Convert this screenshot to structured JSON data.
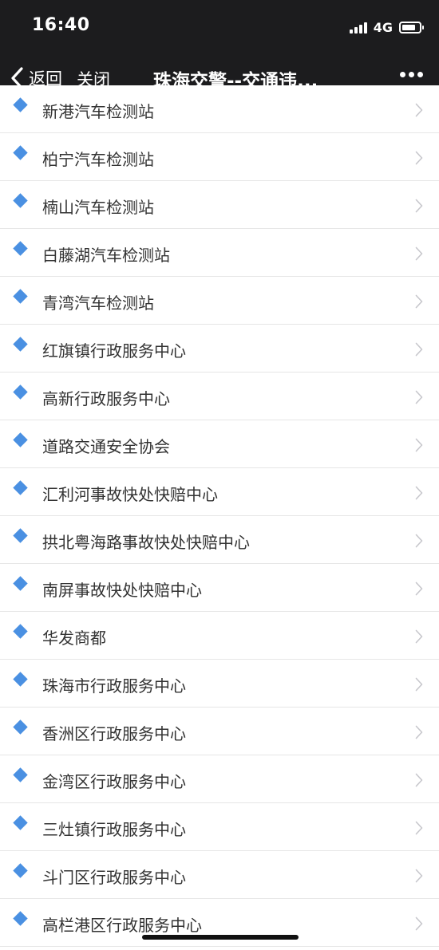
{
  "status_bar": {
    "time": "16:40",
    "network": "4G"
  },
  "nav": {
    "back_label": "返回",
    "close_label": "关闭",
    "title": "珠海交警--交通违..."
  },
  "items": [
    "新港汽车检测站",
    "柏宁汽车检测站",
    "楠山汽车检测站",
    "白藤湖汽车检测站",
    "青湾汽车检测站",
    "红旗镇行政服务中心",
    "高新行政服务中心",
    "道路交通安全协会",
    "汇利河事故快处快赔中心",
    "拱北粤海路事故快处快赔中心",
    "南屏事故快处快赔中心",
    "华发商都",
    "珠海市行政服务中心",
    "香洲区行政服务中心",
    "金湾区行政服务中心",
    "三灶镇行政服务中心",
    "斗门区行政服务中心",
    "高栏港区行政服务中心"
  ],
  "colors": {
    "bar_background": "#1c1c1e",
    "diamond": "#4a90e2",
    "text": "#333333",
    "chevron": "#c7c7cc"
  }
}
